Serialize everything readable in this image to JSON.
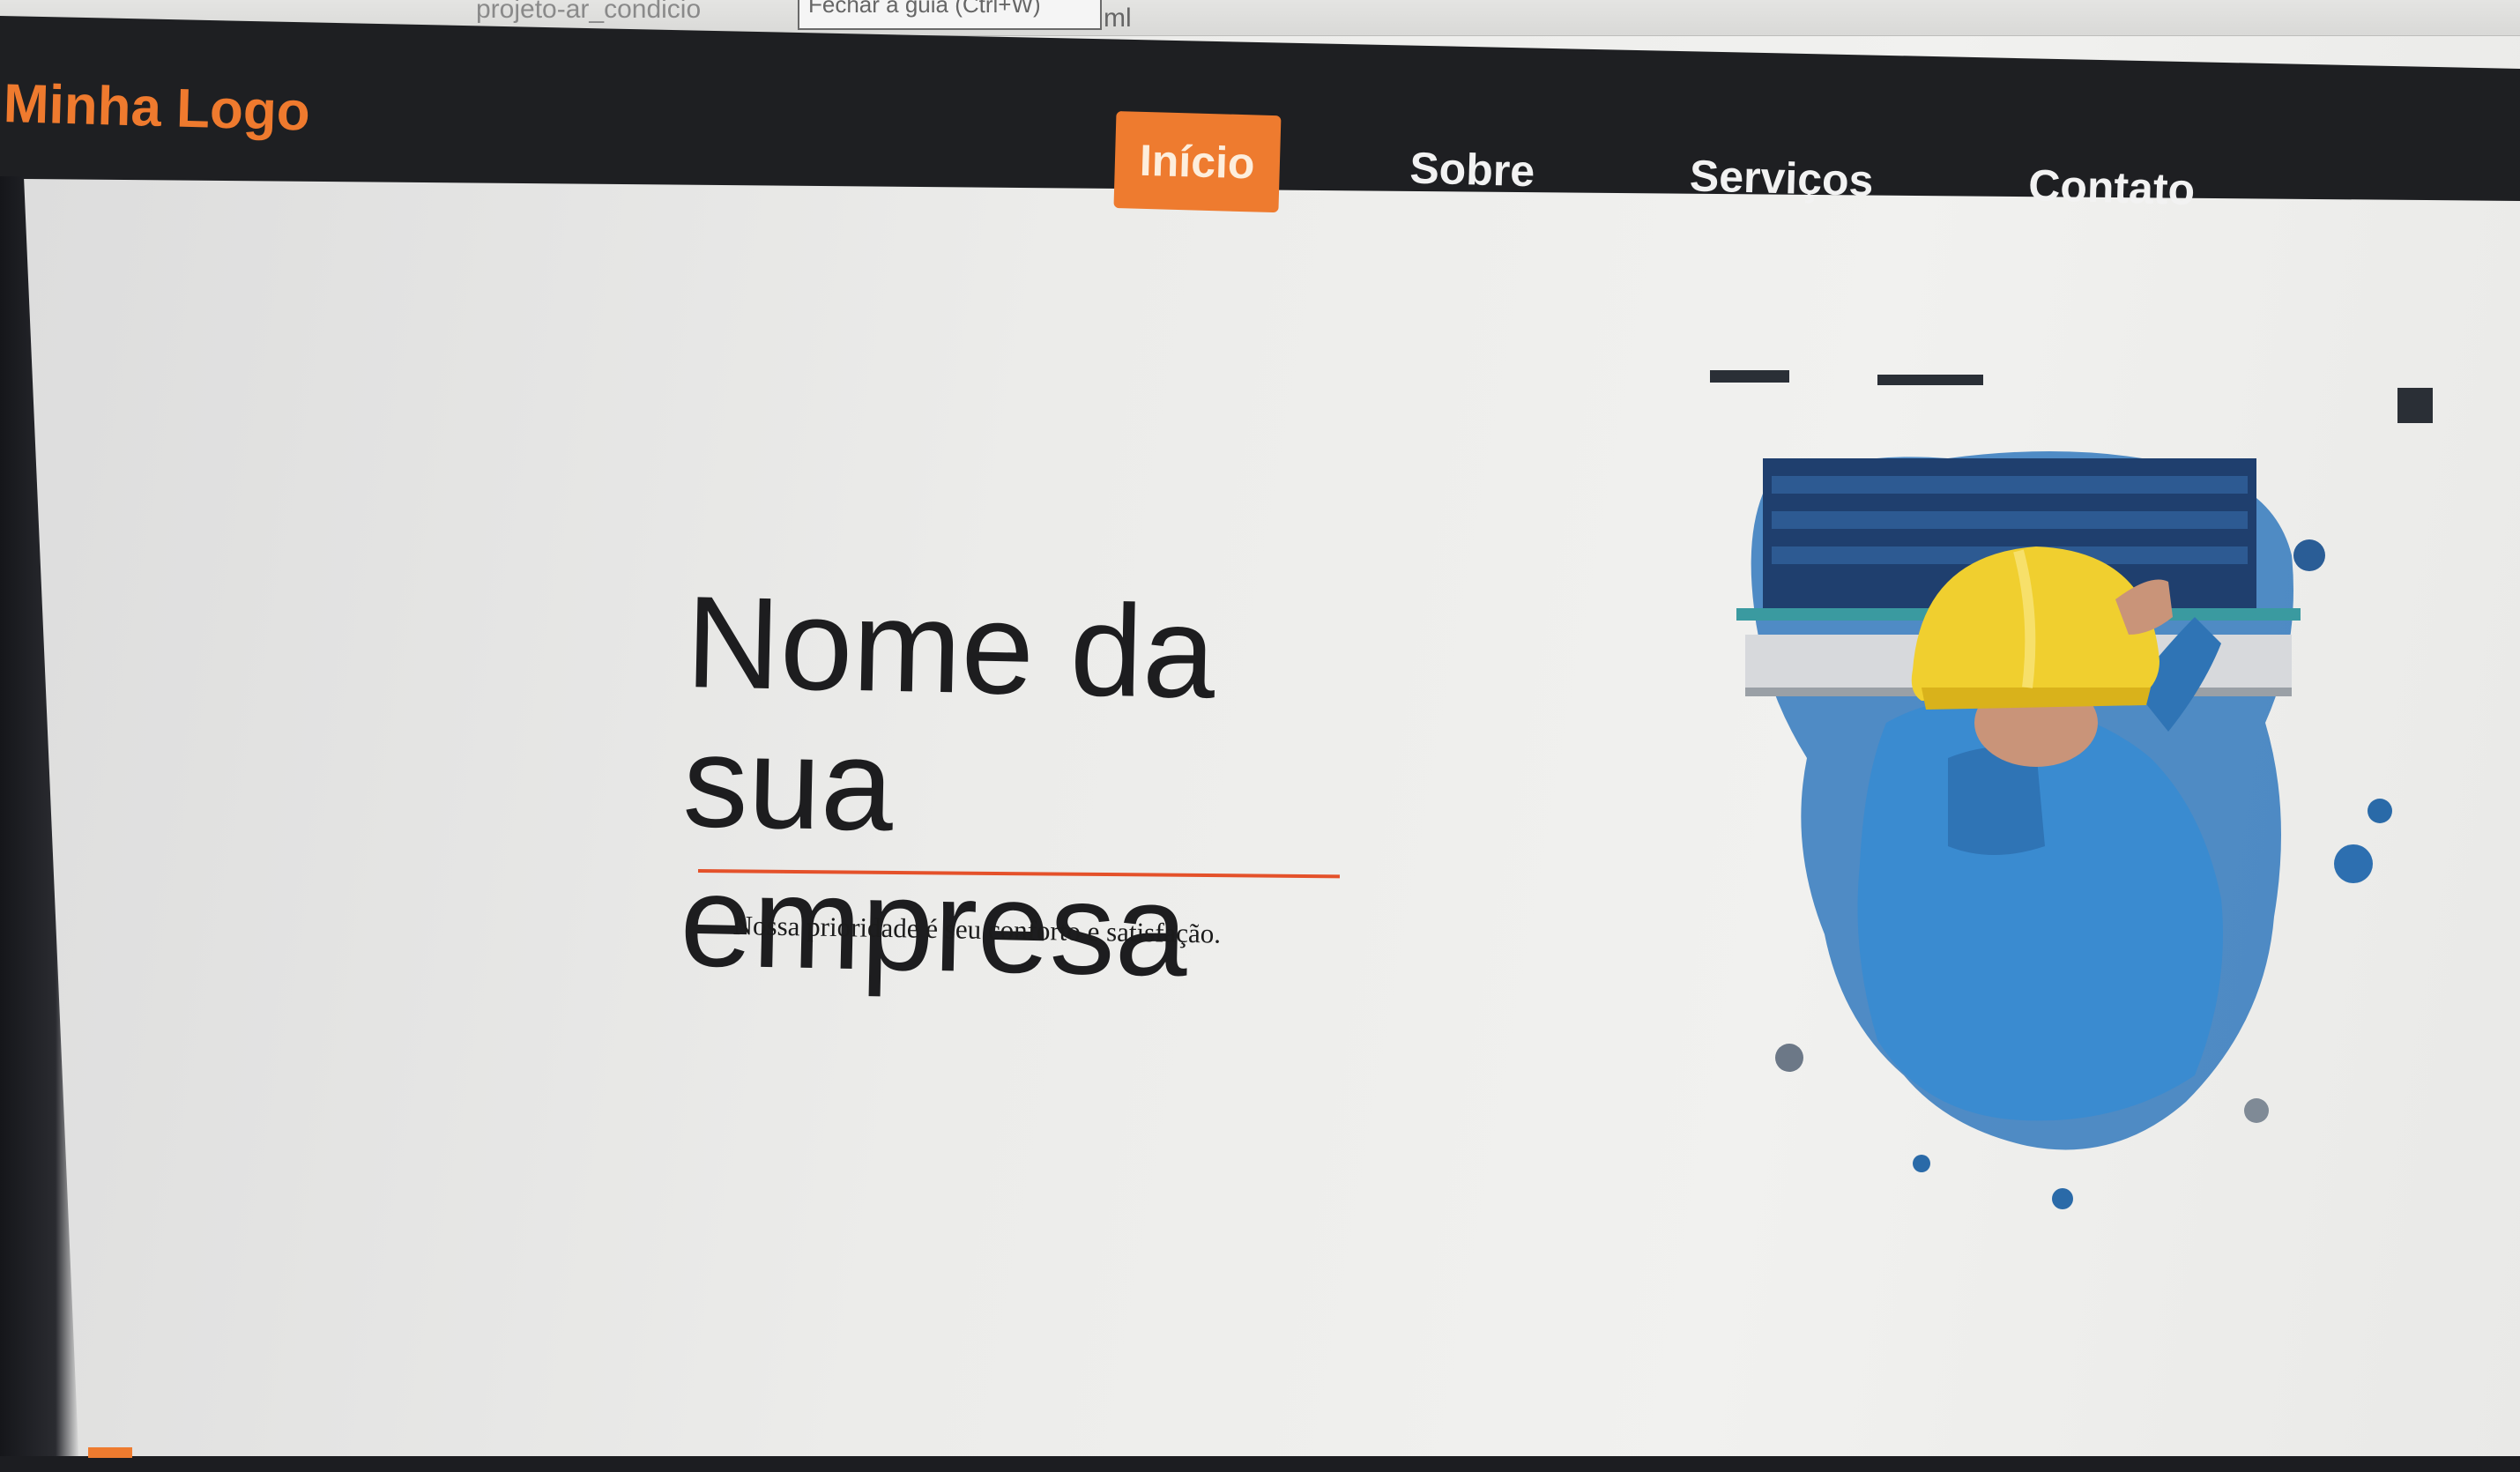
{
  "browser": {
    "url_fragment": "projeto-ar_condicio",
    "tooltip": "Fechar a guia (Ctrl+W)",
    "url_tail": "ml"
  },
  "header": {
    "logo": "Minha Logo",
    "nav": [
      {
        "label": "Início",
        "active": true
      },
      {
        "label": "Sobre",
        "active": false
      },
      {
        "label": "Serviços",
        "active": false
      },
      {
        "label": "Contato",
        "active": false
      }
    ]
  },
  "hero": {
    "title": "Nome da sua empresa",
    "subtitle": "Nossa prioridade é seu conforto e satisfação."
  },
  "colors": {
    "accent": "#ee7b2f",
    "navbar": "#1e1f22",
    "divider": "#e4512a"
  }
}
